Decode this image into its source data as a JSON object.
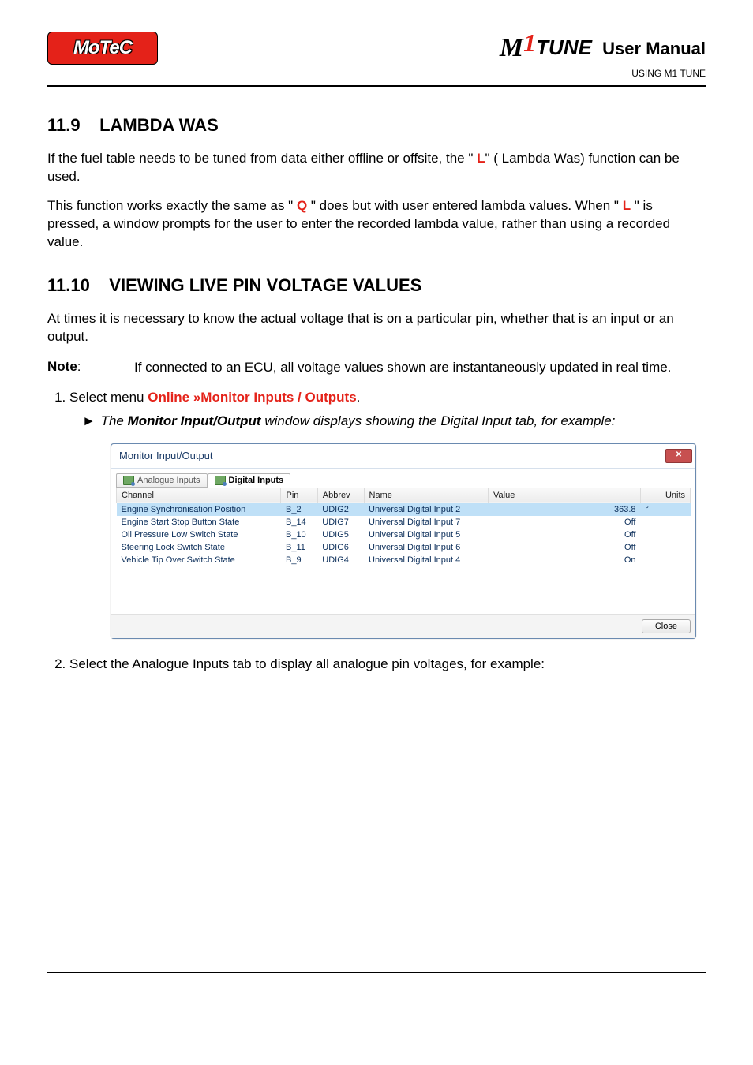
{
  "header": {
    "logo_text": "MoTeC",
    "brand_m": "M",
    "brand_one": "1",
    "brand_tune": "TUNE",
    "brand_user_manual": "User Manual",
    "subhead": "USING M1 TUNE"
  },
  "sections": {
    "s1_number": "11.9",
    "s1_title": "LAMBDA WAS",
    "s1_p1a": "If the fuel table needs to be tuned from data either offline or offsite, the \" ",
    "s1_p1_key": "L",
    "s1_p1b": "\" ( Lambda Was) function can be used.",
    "s1_p2a": "This function works exactly the same as \" ",
    "s1_p2_keyQ": "Q",
    "s1_p2b": " \" does but with user entered lambda values. When \" ",
    "s1_p2_keyL": "L",
    "s1_p2c": " \" is pressed, a window prompts for the user to enter the recorded lambda value, rather than using a recorded value.",
    "s2_number": "11.10",
    "s2_title": "VIEWING LIVE PIN VOLTAGE VALUES",
    "s2_p1": "At times it is necessary to know the actual voltage that is on a particular pin, whether that is an input or an output.",
    "note_label": "Note",
    "note_text": "If connected to an ECU, all voltage values shown are instantaneously updated in real time.",
    "step1_lead": "Select menu ",
    "step1_menu": "Online »Monitor Inputs / Outputs",
    "step1_tail": ".",
    "arrow_pre": "The ",
    "arrow_bold": "Monitor Input/Output",
    "arrow_post": " window displays showing the Digital Input tab, for example:",
    "step2": "Select the Analogue Inputs tab to display all analogue pin voltages, for example:"
  },
  "dialog": {
    "title": "Monitor Input/Output",
    "tabs": {
      "analogue": "Analogue Inputs",
      "digital": "Digital Inputs"
    },
    "columns": {
      "channel": "Channel",
      "pin": "Pin",
      "abbrev": "Abbrev",
      "name": "Name",
      "value": "Value",
      "units": "Units"
    },
    "close_label_pre": "Cl",
    "close_label_accel": "o",
    "close_label_post": "se",
    "winclose": "✕",
    "rows": [
      {
        "channel": "Engine Synchronisation Position",
        "pin": "B_2",
        "abbrev": "UDIG2",
        "name": "Universal Digital Input 2",
        "value": "363.8",
        "units": "°",
        "selected": true
      },
      {
        "channel": "Engine Start Stop Button State",
        "pin": "B_14",
        "abbrev": "UDIG7",
        "name": "Universal Digital Input 7",
        "value": "Off",
        "units": "",
        "selected": false
      },
      {
        "channel": "Oil Pressure Low Switch State",
        "pin": "B_10",
        "abbrev": "UDIG5",
        "name": "Universal Digital Input 5",
        "value": "Off",
        "units": "",
        "selected": false
      },
      {
        "channel": "Steering Lock Switch State",
        "pin": "B_11",
        "abbrev": "UDIG6",
        "name": "Universal Digital Input 6",
        "value": "Off",
        "units": "",
        "selected": false
      },
      {
        "channel": "Vehicle Tip Over Switch State",
        "pin": "B_9",
        "abbrev": "UDIG4",
        "name": "Universal Digital Input 4",
        "value": "On",
        "units": "",
        "selected": false
      }
    ]
  }
}
